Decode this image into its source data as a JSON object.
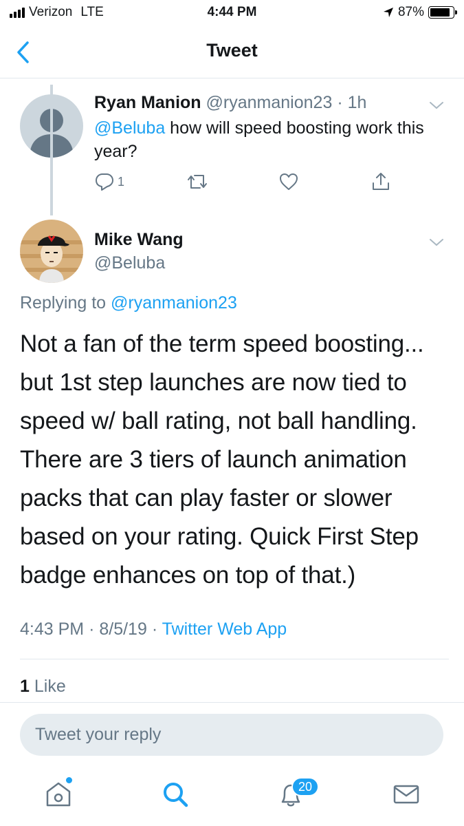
{
  "status_bar": {
    "carrier": "Verizon",
    "network": "LTE",
    "time": "4:44 PM",
    "battery_percent": "87%",
    "battery_level": 0.87,
    "icons": [
      "signal-icon",
      "location-arrow-icon",
      "battery-icon"
    ]
  },
  "header": {
    "title": "Tweet",
    "back_icon": "chevron-left-icon"
  },
  "parent_tweet": {
    "name": "Ryan Manion",
    "handle": "@ryanmanion23",
    "separator": "·",
    "time": "1h",
    "mention": "@Beluba",
    "text": " how will speed boosting work this year?",
    "reply_count": "1",
    "action_icons": [
      "reply-icon",
      "retweet-icon",
      "like-icon",
      "share-icon"
    ]
  },
  "main_tweet": {
    "name": "Mike Wang",
    "handle": "@Beluba",
    "replying_prefix": "Replying to ",
    "replying_handle": "@ryanmanion23",
    "text": "Not a fan of the term speed boosting... but 1st step launches are now tied to speed w/ ball rating, not ball handling. There are 3 tiers of launch animation packs that can play faster or slower based on your rating. Quick First Step badge enhances on top of that.)",
    "time": "4:43 PM",
    "separator": "·",
    "date": "8/5/19",
    "source": "Twitter Web App",
    "like_count": "1",
    "like_label": "Like"
  },
  "reply_box": {
    "placeholder": "Tweet your reply"
  },
  "tab_bar": {
    "notifications_badge": "20",
    "icons": [
      "home-icon",
      "search-icon",
      "notifications-bell-icon",
      "messages-envelope-icon"
    ]
  },
  "colors": {
    "accent": "#1da1f2",
    "text": "#14171a",
    "secondary": "#657786",
    "divider": "#e1e8ed"
  }
}
